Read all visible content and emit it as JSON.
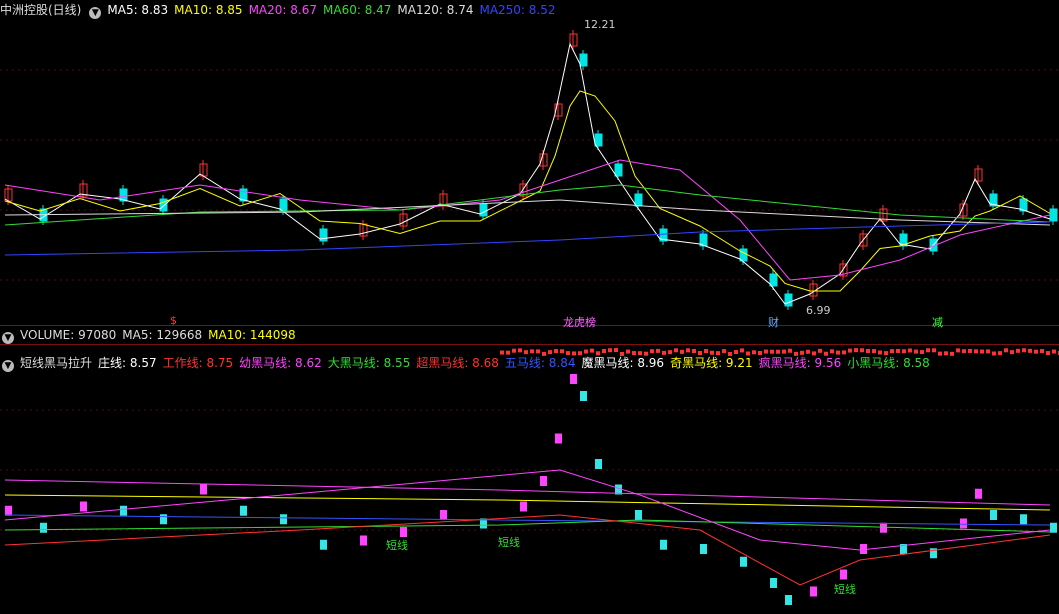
{
  "top": {
    "stock": "中洲控股(日线)",
    "ma": [
      {
        "label": "MA5: 8.83",
        "color": "#ffffff"
      },
      {
        "label": "MA10: 8.85",
        "color": "#ffff00"
      },
      {
        "label": "MA20: 8.67",
        "color": "#ff44ff"
      },
      {
        "label": "MA60: 8.47",
        "color": "#33dd33"
      },
      {
        "label": "MA120: 8.74",
        "color": "#dddddd"
      },
      {
        "label": "MA250: 8.52",
        "color": "#3344ff"
      }
    ],
    "high_label": "12.21",
    "low_label": "6.99",
    "events": [
      {
        "text": "$",
        "color": "#ff3333"
      },
      {
        "text": "龙虎榜",
        "color": "#ff66ff"
      },
      {
        "text": "财",
        "color": "#66aaff"
      },
      {
        "text": "减",
        "color": "#44ff44"
      }
    ]
  },
  "volume": {
    "label": "VOLUME: 97080",
    "ma5": "MA5: 129668",
    "ma10": "MA10: 144098"
  },
  "indicator": {
    "name": "短线黑马拉升",
    "lines": [
      {
        "label": "庄线: 8.57",
        "color": "#ffffff"
      },
      {
        "label": "工作线: 8.75",
        "color": "#ff3333"
      },
      {
        "label": "幼黑马线: 8.62",
        "color": "#ff44ff"
      },
      {
        "label": "大黑马线: 8.55",
        "color": "#33dd33"
      },
      {
        "label": "超黑马线: 8.68",
        "color": "#ff3333"
      },
      {
        "label": "五马线: 8.84",
        "color": "#3355ff"
      },
      {
        "label": "魔黑马线: 8.96",
        "color": "#ffffff"
      },
      {
        "label": "奇黑马线: 9.21",
        "color": "#ffff00"
      },
      {
        "label": "疯黑马线: 9.56",
        "color": "#ff44ff"
      },
      {
        "label": "小黑马线: 8.58",
        "color": "#33dd33"
      }
    ],
    "signal_label": "短线"
  },
  "colors": {
    "up": "#ff3333",
    "down": "#00e5e5",
    "sep": "#7a1010"
  }
}
